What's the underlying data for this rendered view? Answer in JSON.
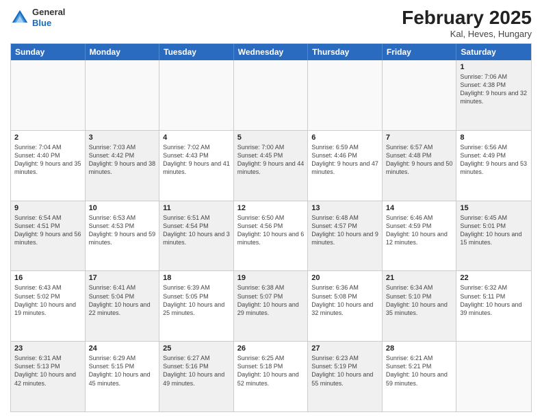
{
  "header": {
    "logo_general": "General",
    "logo_blue": "Blue",
    "month_year": "February 2025",
    "location": "Kal, Heves, Hungary"
  },
  "weekdays": [
    "Sunday",
    "Monday",
    "Tuesday",
    "Wednesday",
    "Thursday",
    "Friday",
    "Saturday"
  ],
  "rows": [
    [
      {
        "day": "",
        "info": "",
        "empty": true
      },
      {
        "day": "",
        "info": "",
        "empty": true
      },
      {
        "day": "",
        "info": "",
        "empty": true
      },
      {
        "day": "",
        "info": "",
        "empty": true
      },
      {
        "day": "",
        "info": "",
        "empty": true
      },
      {
        "day": "",
        "info": "",
        "empty": true
      },
      {
        "day": "1",
        "info": "Sunrise: 7:06 AM\nSunset: 4:38 PM\nDaylight: 9 hours and 32 minutes.",
        "shaded": true
      }
    ],
    [
      {
        "day": "2",
        "info": "Sunrise: 7:04 AM\nSunset: 4:40 PM\nDaylight: 9 hours and 35 minutes."
      },
      {
        "day": "3",
        "info": "Sunrise: 7:03 AM\nSunset: 4:42 PM\nDaylight: 9 hours and 38 minutes.",
        "shaded": true
      },
      {
        "day": "4",
        "info": "Sunrise: 7:02 AM\nSunset: 4:43 PM\nDaylight: 9 hours and 41 minutes."
      },
      {
        "day": "5",
        "info": "Sunrise: 7:00 AM\nSunset: 4:45 PM\nDaylight: 9 hours and 44 minutes.",
        "shaded": true
      },
      {
        "day": "6",
        "info": "Sunrise: 6:59 AM\nSunset: 4:46 PM\nDaylight: 9 hours and 47 minutes."
      },
      {
        "day": "7",
        "info": "Sunrise: 6:57 AM\nSunset: 4:48 PM\nDaylight: 9 hours and 50 minutes.",
        "shaded": true
      },
      {
        "day": "8",
        "info": "Sunrise: 6:56 AM\nSunset: 4:49 PM\nDaylight: 9 hours and 53 minutes."
      }
    ],
    [
      {
        "day": "9",
        "info": "Sunrise: 6:54 AM\nSunset: 4:51 PM\nDaylight: 9 hours and 56 minutes.",
        "shaded": true
      },
      {
        "day": "10",
        "info": "Sunrise: 6:53 AM\nSunset: 4:53 PM\nDaylight: 9 hours and 59 minutes."
      },
      {
        "day": "11",
        "info": "Sunrise: 6:51 AM\nSunset: 4:54 PM\nDaylight: 10 hours and 3 minutes.",
        "shaded": true
      },
      {
        "day": "12",
        "info": "Sunrise: 6:50 AM\nSunset: 4:56 PM\nDaylight: 10 hours and 6 minutes."
      },
      {
        "day": "13",
        "info": "Sunrise: 6:48 AM\nSunset: 4:57 PM\nDaylight: 10 hours and 9 minutes.",
        "shaded": true
      },
      {
        "day": "14",
        "info": "Sunrise: 6:46 AM\nSunset: 4:59 PM\nDaylight: 10 hours and 12 minutes."
      },
      {
        "day": "15",
        "info": "Sunrise: 6:45 AM\nSunset: 5:01 PM\nDaylight: 10 hours and 15 minutes.",
        "shaded": true
      }
    ],
    [
      {
        "day": "16",
        "info": "Sunrise: 6:43 AM\nSunset: 5:02 PM\nDaylight: 10 hours and 19 minutes."
      },
      {
        "day": "17",
        "info": "Sunrise: 6:41 AM\nSunset: 5:04 PM\nDaylight: 10 hours and 22 minutes.",
        "shaded": true
      },
      {
        "day": "18",
        "info": "Sunrise: 6:39 AM\nSunset: 5:05 PM\nDaylight: 10 hours and 25 minutes."
      },
      {
        "day": "19",
        "info": "Sunrise: 6:38 AM\nSunset: 5:07 PM\nDaylight: 10 hours and 29 minutes.",
        "shaded": true
      },
      {
        "day": "20",
        "info": "Sunrise: 6:36 AM\nSunset: 5:08 PM\nDaylight: 10 hours and 32 minutes."
      },
      {
        "day": "21",
        "info": "Sunrise: 6:34 AM\nSunset: 5:10 PM\nDaylight: 10 hours and 35 minutes.",
        "shaded": true
      },
      {
        "day": "22",
        "info": "Sunrise: 6:32 AM\nSunset: 5:11 PM\nDaylight: 10 hours and 39 minutes."
      }
    ],
    [
      {
        "day": "23",
        "info": "Sunrise: 6:31 AM\nSunset: 5:13 PM\nDaylight: 10 hours and 42 minutes.",
        "shaded": true
      },
      {
        "day": "24",
        "info": "Sunrise: 6:29 AM\nSunset: 5:15 PM\nDaylight: 10 hours and 45 minutes."
      },
      {
        "day": "25",
        "info": "Sunrise: 6:27 AM\nSunset: 5:16 PM\nDaylight: 10 hours and 49 minutes.",
        "shaded": true
      },
      {
        "day": "26",
        "info": "Sunrise: 6:25 AM\nSunset: 5:18 PM\nDaylight: 10 hours and 52 minutes."
      },
      {
        "day": "27",
        "info": "Sunrise: 6:23 AM\nSunset: 5:19 PM\nDaylight: 10 hours and 55 minutes.",
        "shaded": true
      },
      {
        "day": "28",
        "info": "Sunrise: 6:21 AM\nSunset: 5:21 PM\nDaylight: 10 hours and 59 minutes."
      },
      {
        "day": "",
        "info": "",
        "empty": true
      }
    ]
  ]
}
